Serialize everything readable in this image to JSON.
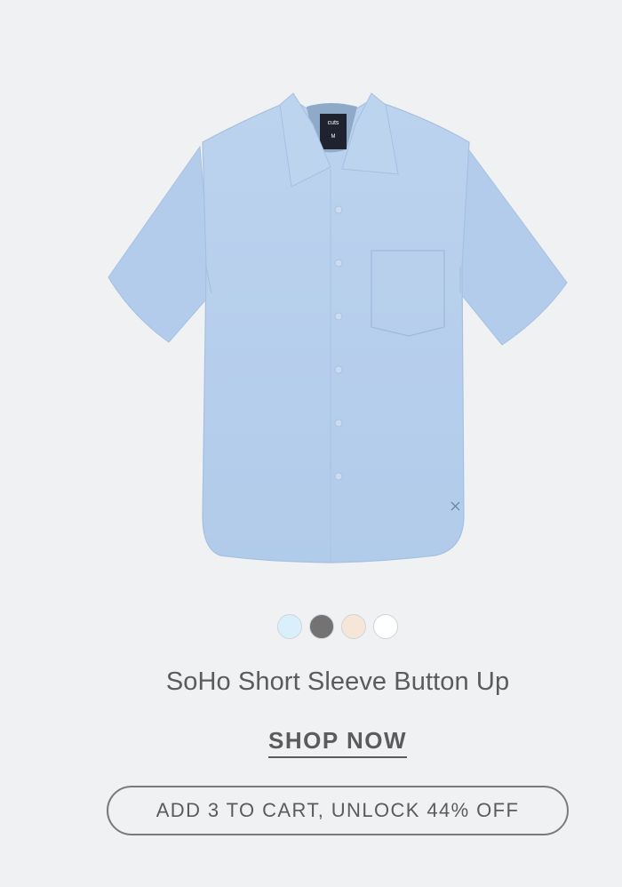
{
  "product": {
    "image": {
      "label_brand": "cuts",
      "label_size": "M",
      "alt_icon": "shirt-image"
    },
    "swatches": [
      {
        "name": "light-blue",
        "color": "#d9f0fa"
      },
      {
        "name": "charcoal",
        "color": "#737373"
      },
      {
        "name": "cream",
        "color": "#f5e6d8"
      },
      {
        "name": "white",
        "color": "#ffffff"
      }
    ],
    "title": "SoHo Short Sleeve Button Up",
    "shop_now_label": "SHOP NOW",
    "cart_button_label": "ADD 3 TO CART, UNLOCK 44% OFF"
  },
  "colors": {
    "background": "#eff1f3",
    "shirt": "#b6cfec",
    "text": "#5b5b5b"
  }
}
